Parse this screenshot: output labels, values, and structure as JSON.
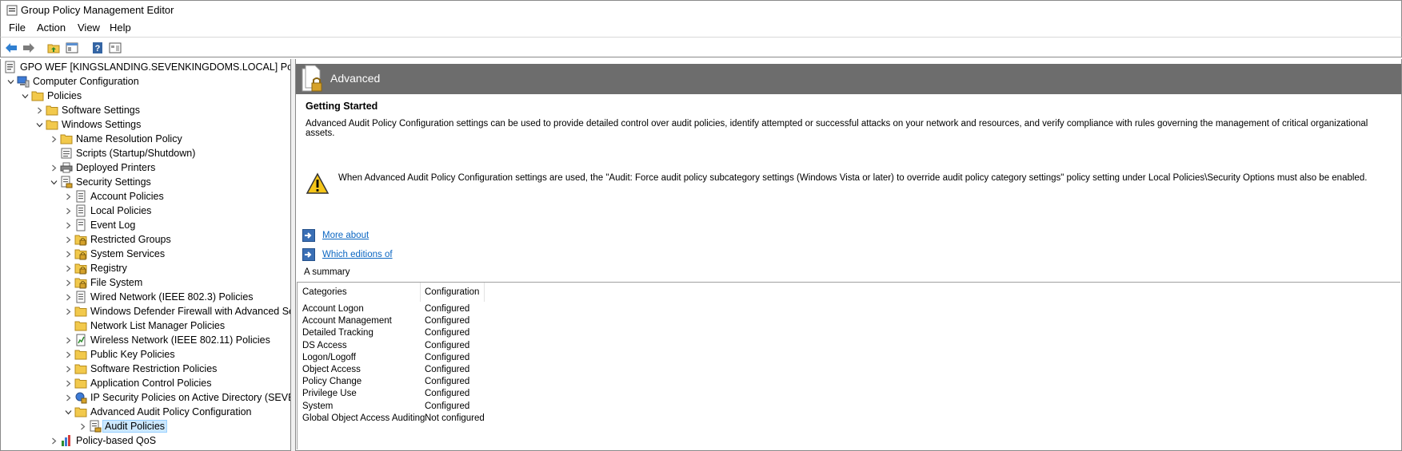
{
  "window": {
    "title": "Group Policy Management Editor"
  },
  "menu": [
    "File",
    "Action",
    "View",
    "Help"
  ],
  "toolbar": {
    "buttons": [
      {
        "name": "back-arrow-icon"
      },
      {
        "name": "forward-arrow-icon"
      },
      {
        "name": "up-folder-icon"
      },
      {
        "name": "show-hide-tree-icon"
      },
      {
        "name": "help-icon"
      },
      {
        "name": "properties-icon"
      }
    ]
  },
  "tree": [
    {
      "label": "GPO WEF [KINGSLANDING.SEVENKINGDOMS.LOCAL] Policy",
      "depth": 0,
      "expander": "none",
      "icon": "gpo-icon"
    },
    {
      "label": "Computer Configuration",
      "depth": 0,
      "expander": "expanded",
      "icon": "computer-icon"
    },
    {
      "label": "Policies",
      "depth": 1,
      "expander": "expanded",
      "icon": "folder-icon"
    },
    {
      "label": "Software Settings",
      "depth": 2,
      "expander": "collapsed",
      "icon": "folder-icon"
    },
    {
      "label": "Windows Settings",
      "depth": 2,
      "expander": "expanded",
      "icon": "folder-icon"
    },
    {
      "label": "Name Resolution Policy",
      "depth": 3,
      "expander": "collapsed",
      "icon": "folder-icon"
    },
    {
      "label": "Scripts (Startup/Shutdown)",
      "depth": 3,
      "expander": "none",
      "icon": "script-icon"
    },
    {
      "label": "Deployed Printers",
      "depth": 3,
      "expander": "collapsed",
      "icon": "printer-icon"
    },
    {
      "label": "Security Settings",
      "depth": 3,
      "expander": "expanded",
      "icon": "security-settings-icon"
    },
    {
      "label": "Account Policies",
      "depth": 4,
      "expander": "collapsed",
      "icon": "policy-doc-icon"
    },
    {
      "label": "Local Policies",
      "depth": 4,
      "expander": "collapsed",
      "icon": "policy-doc-icon"
    },
    {
      "label": "Event Log",
      "depth": 4,
      "expander": "collapsed",
      "icon": "event-log-icon"
    },
    {
      "label": "Restricted Groups",
      "depth": 4,
      "expander": "collapsed",
      "icon": "locked-folder-icon"
    },
    {
      "label": "System Services",
      "depth": 4,
      "expander": "collapsed",
      "icon": "locked-folder-icon"
    },
    {
      "label": "Registry",
      "depth": 4,
      "expander": "collapsed",
      "icon": "locked-folder-icon"
    },
    {
      "label": "File System",
      "depth": 4,
      "expander": "collapsed",
      "icon": "locked-folder-icon"
    },
    {
      "label": "Wired Network (IEEE 802.3) Policies",
      "depth": 4,
      "expander": "collapsed",
      "icon": "network-policy-icon"
    },
    {
      "label": "Windows Defender Firewall with Advanced Se",
      "depth": 4,
      "expander": "collapsed",
      "icon": "folder-icon"
    },
    {
      "label": "Network List Manager Policies",
      "depth": 4,
      "expander": "none",
      "icon": "folder-icon"
    },
    {
      "label": "Wireless Network (IEEE 802.11) Policies",
      "depth": 4,
      "expander": "collapsed",
      "icon": "wireless-policy-icon"
    },
    {
      "label": "Public Key Policies",
      "depth": 4,
      "expander": "collapsed",
      "icon": "folder-icon"
    },
    {
      "label": "Software Restriction Policies",
      "depth": 4,
      "expander": "collapsed",
      "icon": "folder-icon"
    },
    {
      "label": "Application Control Policies",
      "depth": 4,
      "expander": "collapsed",
      "icon": "folder-icon"
    },
    {
      "label": "IP Security Policies on Active Directory (SEVEN",
      "depth": 4,
      "expander": "collapsed",
      "icon": "ip-security-icon"
    },
    {
      "label": "Advanced Audit Policy Configuration",
      "depth": 4,
      "expander": "expanded",
      "icon": "folder-icon"
    },
    {
      "label": "Audit Policies",
      "depth": 5,
      "expander": "collapsed",
      "icon": "audit-policies-icon",
      "selected": true
    },
    {
      "label": "Policy-based QoS",
      "depth": 3,
      "expander": "collapsed",
      "icon": "qos-chart-icon"
    }
  ],
  "details": {
    "header_title": "Advanced",
    "getting_started": "Getting Started",
    "description": "Advanced Audit Policy Configuration settings can be used to provide detailed control over audit policies, identify attempted or successful attacks on your network and resources, and verify compliance with rules governing the management of critical organizational assets.",
    "warning": "When Advanced Audit Policy Configuration settings are used, the \"Audit: Force audit policy subcategory settings (Windows Vista or later) to override audit policy category settings\" policy setting under Local Policies\\Security Options must also be enabled.",
    "links": [
      "More about",
      "Which editions of"
    ],
    "summary_label": "A summary",
    "columns": [
      "Categories",
      "Configuration"
    ],
    "rows": [
      [
        "Account Logon",
        "Configured"
      ],
      [
        "Account Management",
        "Configured"
      ],
      [
        "Detailed Tracking",
        "Configured"
      ],
      [
        "DS Access",
        "Configured"
      ],
      [
        "Logon/Logoff",
        "Configured"
      ],
      [
        "Object Access",
        "Configured"
      ],
      [
        "Policy Change",
        "Configured"
      ],
      [
        "Privilege Use",
        "Configured"
      ],
      [
        "System",
        "Configured"
      ],
      [
        "Global Object Access Auditing",
        "Not configured"
      ]
    ]
  },
  "colors": {
    "header_bg": "#6d6d6d",
    "link": "#0b66c2",
    "selection": "#cce8ff",
    "folder": "#f2c94c"
  }
}
